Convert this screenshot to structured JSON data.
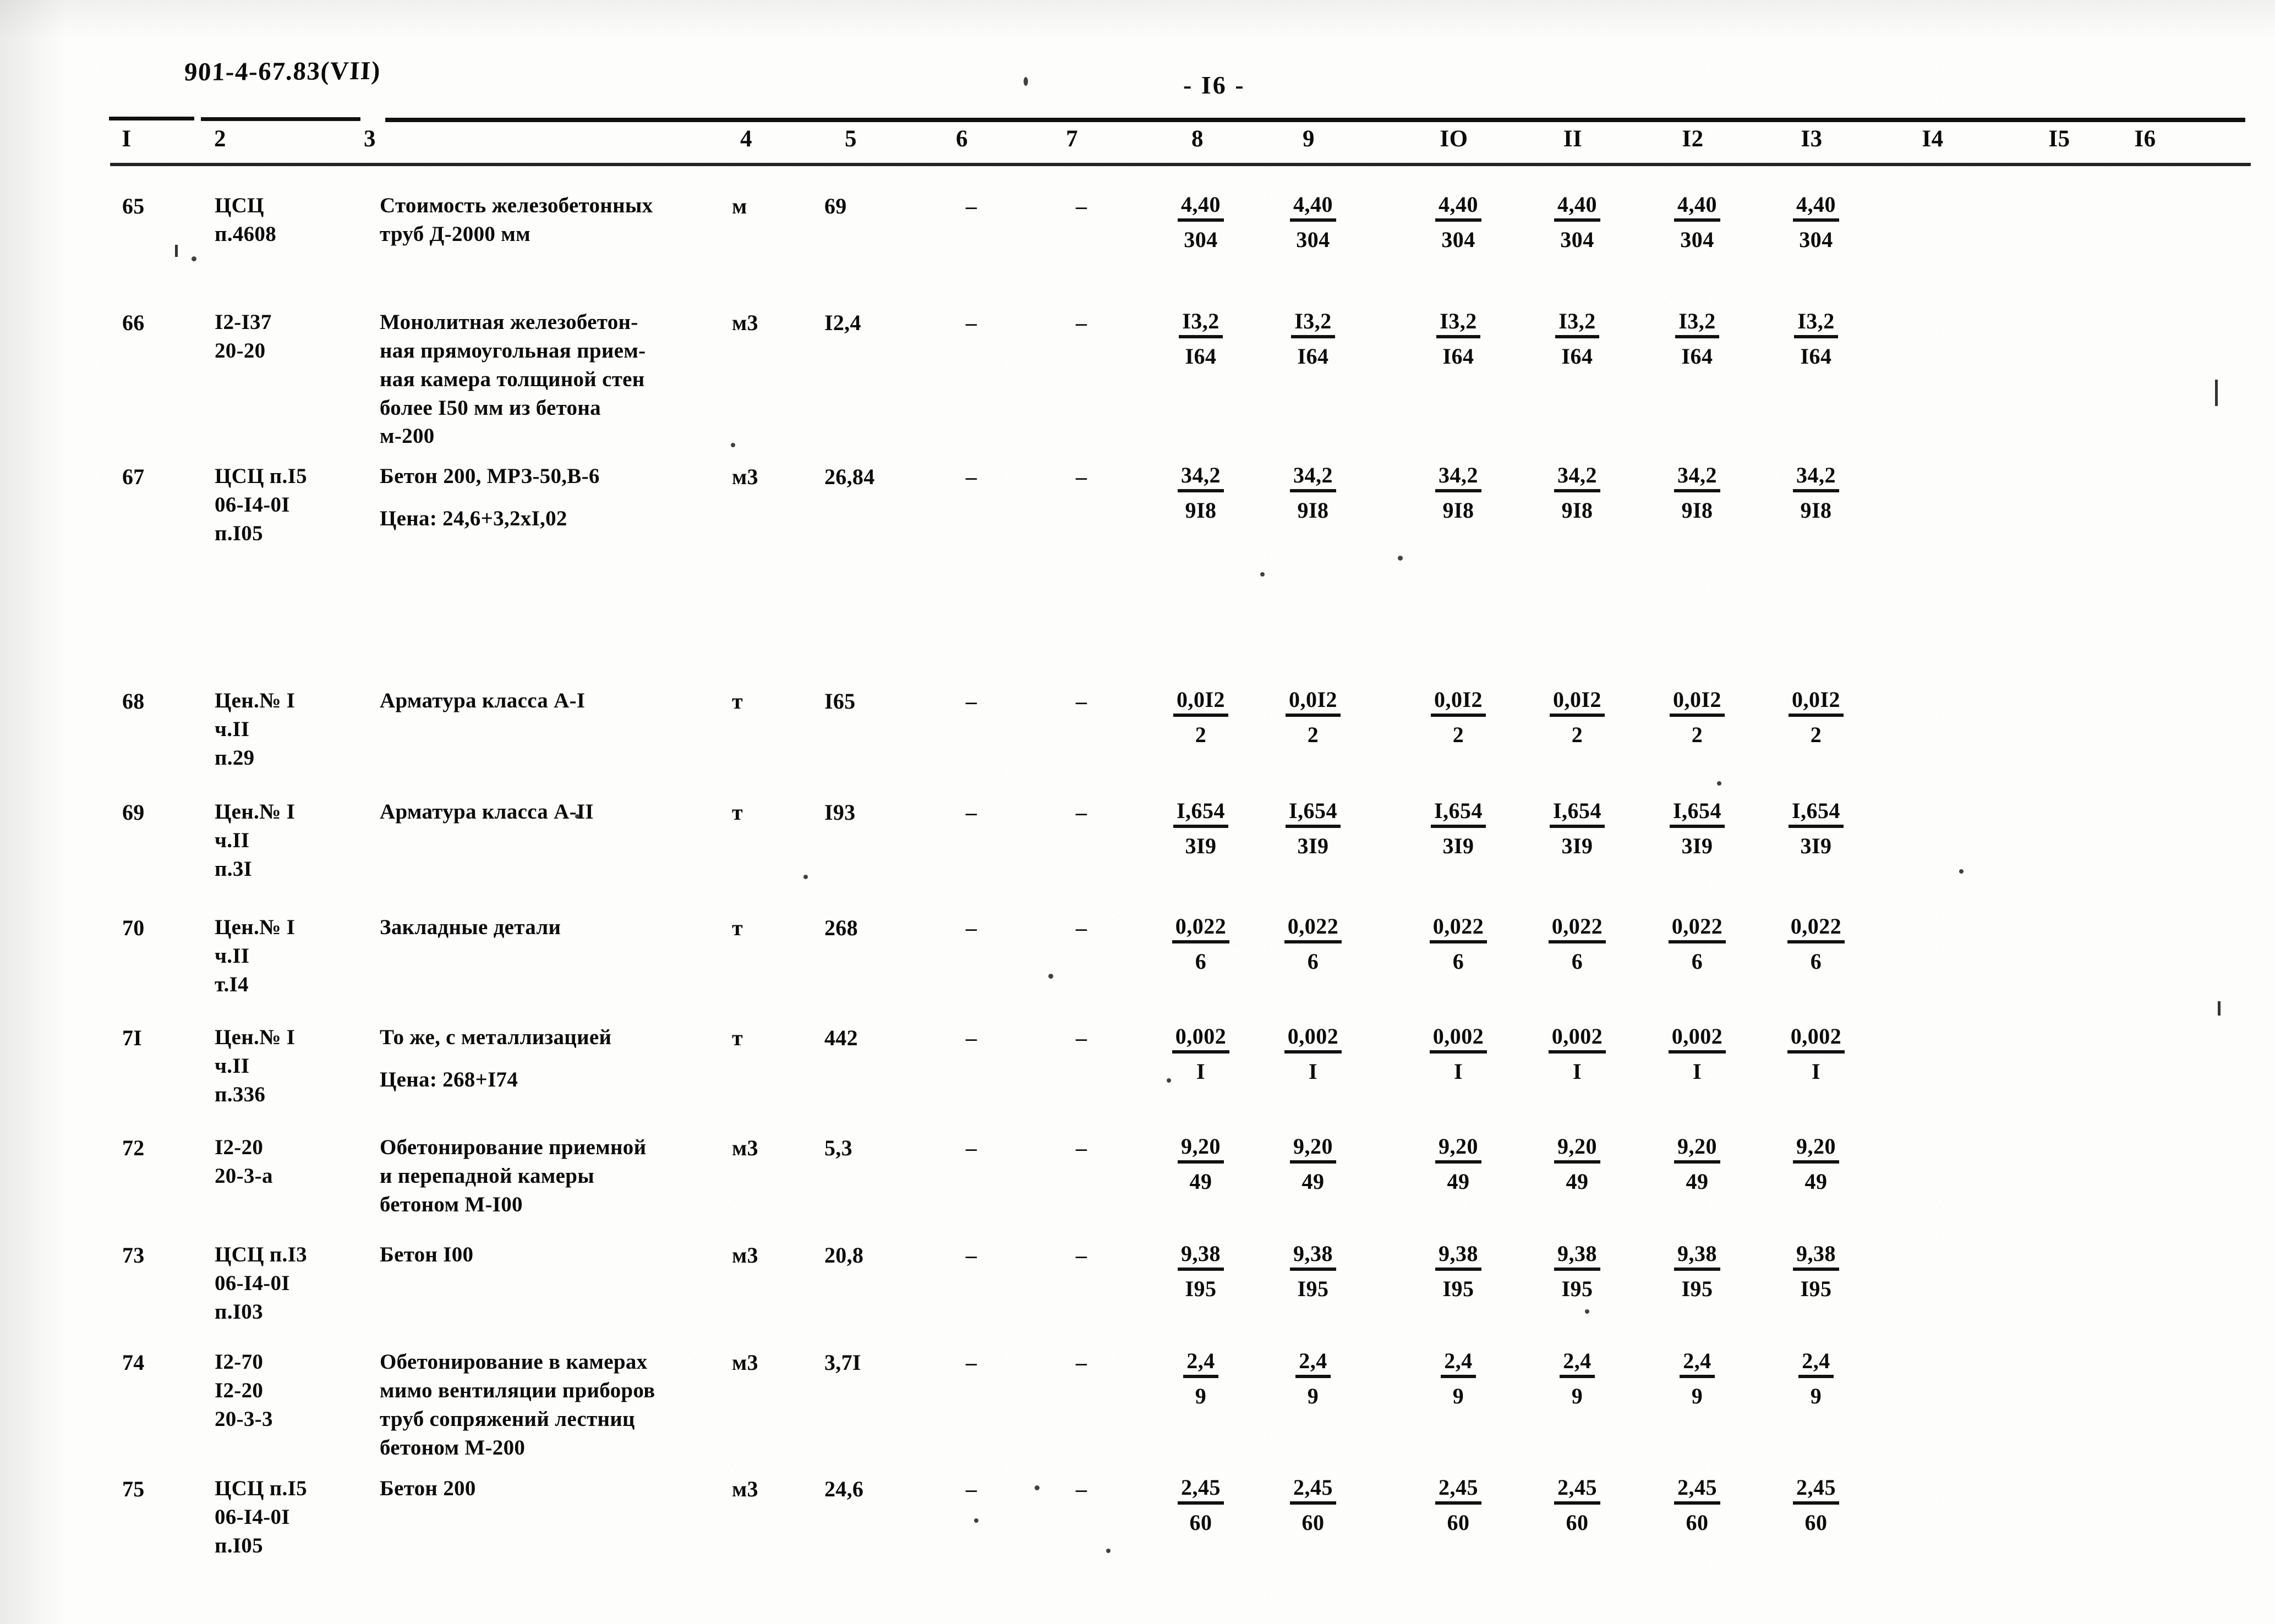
{
  "document": {
    "code": "901-4-67.83(VII)",
    "page_label": "- I6 -"
  },
  "table": {
    "column_headers": [
      "I",
      "2",
      "3",
      "4",
      "5",
      "6",
      "7",
      "8",
      "9",
      "IO",
      "II",
      "I2",
      "I3",
      "I4",
      "I5",
      "I6"
    ],
    "rows": [
      {
        "num": "65",
        "code": "ЦСЦ\nп.4608",
        "desc": "Стоимость железобетонных\nтруб Д-2000 мм",
        "desc_extra": "",
        "unit": "м",
        "qty": "69",
        "col6": "–",
        "col7": "–",
        "numerator": "4,40",
        "denominator": "304"
      },
      {
        "num": "66",
        "code": "I2-I37\n20-20",
        "desc": "Монолитная железобетон-\nная прямоугольная прием-\nная камера толщиной стен\nболее I50 мм из бетона\nм-200",
        "desc_extra": "",
        "unit": "м3",
        "qty": "I2,4",
        "col6": "–",
        "col7": "–",
        "numerator": "I3,2",
        "denominator": "I64"
      },
      {
        "num": "67",
        "code": "ЦСЦ п.I5\n06-I4-0I\nп.I05",
        "desc": "Бетон 200, МРЗ-50,В-6",
        "desc_extra": "Цена: 24,6+3,2xI,02",
        "unit": "м3",
        "qty": "26,84",
        "col6": "–",
        "col7": "–",
        "numerator": "34,2",
        "denominator": "9I8"
      },
      {
        "num": "68",
        "code": "Цен.№ I\nч.II\nп.29",
        "desc": "Арматура класса А-I",
        "desc_extra": "",
        "unit": "т",
        "qty": "I65",
        "col6": "–",
        "col7": "–",
        "numerator": "0,0I2",
        "denominator": "2"
      },
      {
        "num": "69",
        "code": "Цен.№ I\nч.II\nп.3I",
        "desc": "Арматура класса А-II",
        "desc_extra": "",
        "unit": "т",
        "qty": "I93",
        "col6": "–",
        "col7": "–",
        "numerator": "I,654",
        "denominator": "3I9"
      },
      {
        "num": "70",
        "code": "Цен.№ I\nч.II\nт.I4",
        "desc": "Закладные детали",
        "desc_extra": "",
        "unit": "т",
        "qty": "268",
        "col6": "–",
        "col7": "–",
        "numerator": "0,022",
        "denominator": "6"
      },
      {
        "num": "7I",
        "code": "Цен.№ I\nч.II\nп.336",
        "desc": "То же, с металлизацией",
        "desc_extra": "Цена: 268+I74",
        "unit": "т",
        "qty": "442",
        "col6": "–",
        "col7": "–",
        "numerator": "0,002",
        "denominator": "I"
      },
      {
        "num": "72",
        "code": "I2-20\n20-3-а",
        "desc": "Обетонирование приемной\nи перепадной камеры\nбетоном М-I00",
        "desc_extra": "",
        "unit": "м3",
        "qty": "5,3",
        "col6": "–",
        "col7": "–",
        "numerator": "9,20",
        "denominator": "49"
      },
      {
        "num": "73",
        "code": "ЦСЦ п.I3\n06-I4-0I\nп.I03",
        "desc": "Бетон I00",
        "desc_extra": "",
        "unit": "м3",
        "qty": "20,8",
        "col6": "–",
        "col7": "–",
        "numerator": "9,38",
        "denominator": "I95"
      },
      {
        "num": "74",
        "code": "I2-70\nI2-20\n20-3-3",
        "desc": "Обетонирование в камерах\nмимо вентиляции приборов\nтруб сопряжений лестниц\nбетоном М-200",
        "desc_extra": "",
        "unit": "м3",
        "qty": "3,7I",
        "col6": "–",
        "col7": "–",
        "numerator": "2,4",
        "denominator": "9"
      },
      {
        "num": "75",
        "code": "ЦСЦ п.I5\n06-I4-0I\nп.I05",
        "desc": "Бетон 200",
        "desc_extra": "",
        "unit": "м3",
        "qty": "24,6",
        "col6": "–",
        "col7": "–",
        "numerator": "2,45",
        "denominator": "60"
      }
    ]
  }
}
